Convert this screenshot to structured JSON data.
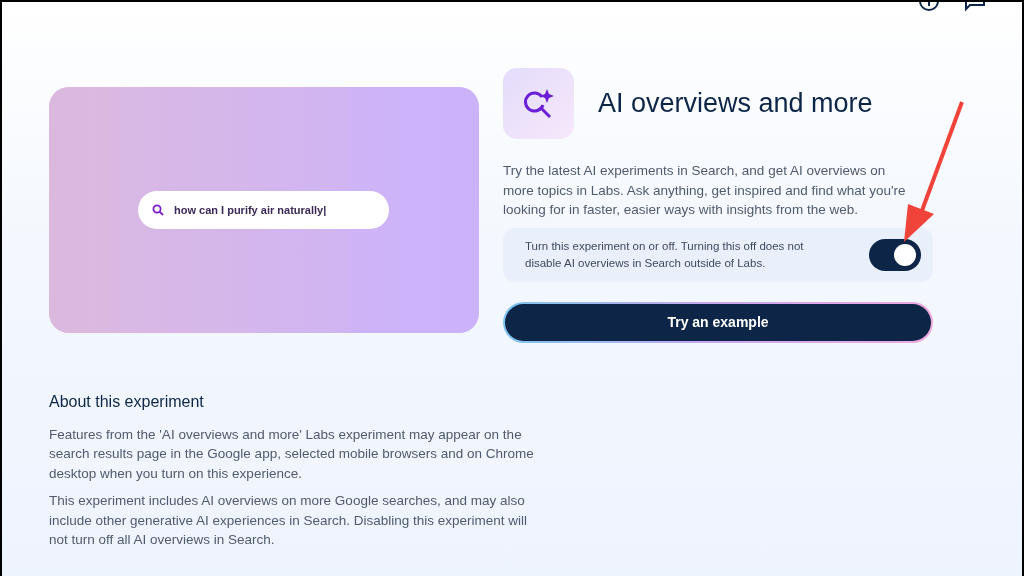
{
  "hero": {
    "search_query": "how can I purify air naturally|"
  },
  "experiment": {
    "title": "AI overviews and more",
    "description": "Try the latest AI experiments in Search, and get AI overviews on more topics in Labs. Ask anything, get inspired and find what you're looking for in faster, easier ways with insights from the web.",
    "toggle": {
      "label": "Turn this experiment on or off. Turning this off does not disable AI overviews in Search outside of Labs.",
      "on": true
    },
    "button": "Try an example"
  },
  "about": {
    "heading": "About this experiment",
    "paragraphs": [
      "Features from the 'AI overviews and more' Labs experiment may appear on the search results page in the Google app, selected mobile browsers and on Chrome desktop when you turn on this experience.",
      "This experiment includes AI overviews on more Google searches, and may also include other generative AI experiences in Search. Disabling this experiment will not turn off all AI overviews in Search."
    ]
  }
}
